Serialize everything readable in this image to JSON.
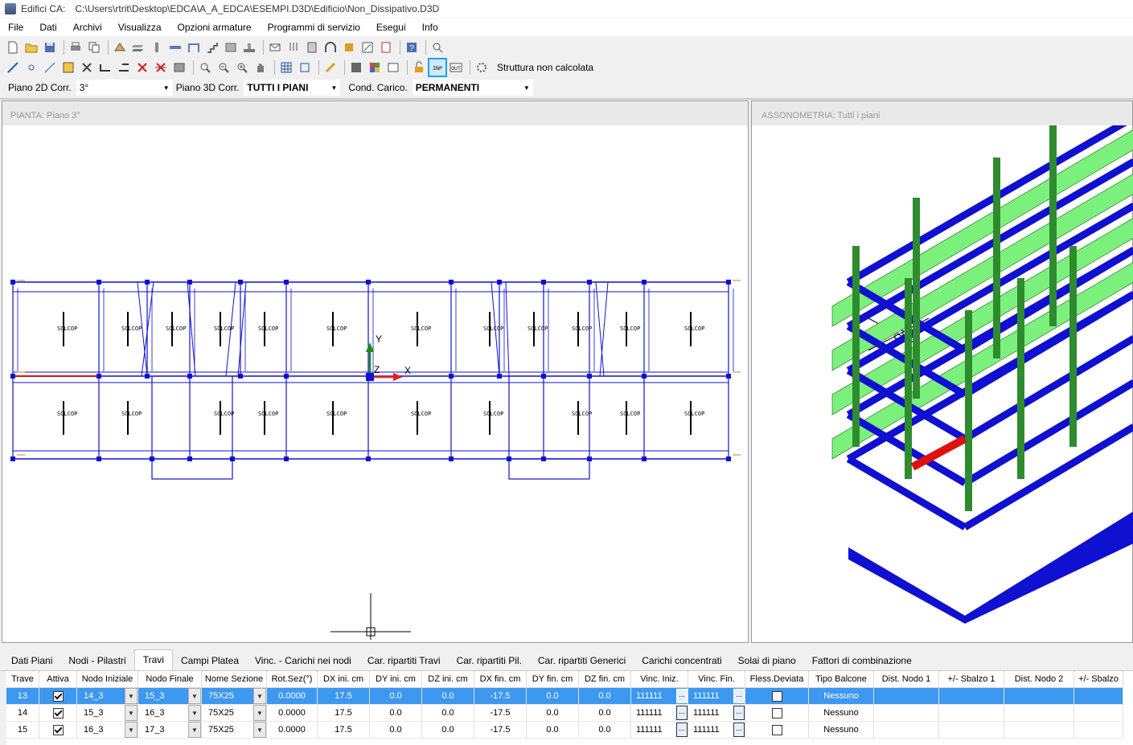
{
  "window": {
    "app_name": "Edifici CA:",
    "file_path": "C:\\Users\\rtrit\\Desktop\\EDCA\\A_A_EDCA\\ESEMPI.D3D\\Edificio\\Non_Dissipativo.D3D"
  },
  "menu": [
    "File",
    "Dati",
    "Archivi",
    "Visualizza",
    "Opzioni armature",
    "Programmi di servizio",
    "Esegui",
    "Info"
  ],
  "toolbar": {
    "status": "Struttura non calcolata",
    "inp_label": "INP",
    "out_label": "OUT"
  },
  "filters": {
    "piano2d_label": "Piano 2D Corr.",
    "piano2d_value": "3°",
    "piano3d_label": "Piano 3D Corr.",
    "piano3d_value": "TUTTI I PIANI",
    "cond_label": "Cond. Carico.",
    "cond_value": "PERMANENTI"
  },
  "left_pane": {
    "title": "PIANTA: Piano   3°",
    "slab_label": "SOLCOP",
    "axis_y": "Y",
    "axis_z": "Z",
    "axis_x": "X"
  },
  "right_pane": {
    "title": "ASSONOMETRIA:  Tutti i piani"
  },
  "tabs": [
    {
      "label": "Dati Piani",
      "active": false
    },
    {
      "label": "Nodi - Pilastri",
      "active": false
    },
    {
      "label": "Travi",
      "active": true
    },
    {
      "label": "Campi Platea",
      "active": false
    },
    {
      "label": "Vinc. - Carichi nei nodi",
      "active": false
    },
    {
      "label": "Car. ripartiti Travi",
      "active": false
    },
    {
      "label": "Car. ripartiti Pil.",
      "active": false
    },
    {
      "label": "Car. ripartiti Generici",
      "active": false
    },
    {
      "label": "Carichi concentrati",
      "active": false
    },
    {
      "label": "Solai di piano",
      "active": false
    },
    {
      "label": "Fattori di combinazione",
      "active": false
    }
  ],
  "table": {
    "columns": [
      "Trave",
      "Attiva",
      "Nodo Iniziale",
      "Nodo Finale",
      "Nome Sezione",
      "Rot.Sez(°)",
      "DX ini. cm",
      "DY ini. cm",
      "DZ ini. cm",
      "DX fin. cm",
      "DY fin. cm",
      "DZ fin. cm",
      "Vinc. Iniz.",
      "Vinc. Fin.",
      "Fless.Deviata",
      "Tipo Balcone",
      "Dist. Nodo 1",
      "+/- Sbalzo 1",
      "Dist. Nodo 2",
      "+/- Sbalzo"
    ],
    "rows": [
      {
        "trave": "13",
        "attiva": true,
        "nodo_ini": "14_3",
        "nodo_fin": "15_3",
        "sezione": "75X25",
        "rot": "0.0000",
        "dx_ini": "17.5",
        "dy_ini": "0.0",
        "dz_ini": "0.0",
        "dx_fin": "-17.5",
        "dy_fin": "0.0",
        "dz_fin": "0.0",
        "vinc_ini": "111111",
        "vinc_fin": "111111",
        "fless": false,
        "balcone": "Nessuno",
        "selected": true
      },
      {
        "trave": "14",
        "attiva": true,
        "nodo_ini": "15_3",
        "nodo_fin": "16_3",
        "sezione": "75X25",
        "rot": "0.0000",
        "dx_ini": "17.5",
        "dy_ini": "0.0",
        "dz_ini": "0.0",
        "dx_fin": "-17.5",
        "dy_fin": "0.0",
        "dz_fin": "0.0",
        "vinc_ini": "111111",
        "vinc_fin": "111111",
        "fless": false,
        "balcone": "Nessuno",
        "selected": false
      },
      {
        "trave": "15",
        "attiva": true,
        "nodo_ini": "16_3",
        "nodo_fin": "17_3",
        "sezione": "75X25",
        "rot": "0.0000",
        "dx_ini": "17.5",
        "dy_ini": "0.0",
        "dz_ini": "0.0",
        "dx_fin": "-17.5",
        "dy_fin": "0.0",
        "dz_fin": "0.0",
        "vinc_ini": "111111",
        "vinc_fin": "111111",
        "fless": false,
        "balcone": "Nessuno",
        "selected": false
      }
    ]
  },
  "colors": {
    "beam_blue": "#1010d0",
    "slab_green": "#7cf07c",
    "column_green": "#2e8b2e",
    "selected_beam": "#e01010",
    "selection_row": "#3d98f0"
  }
}
